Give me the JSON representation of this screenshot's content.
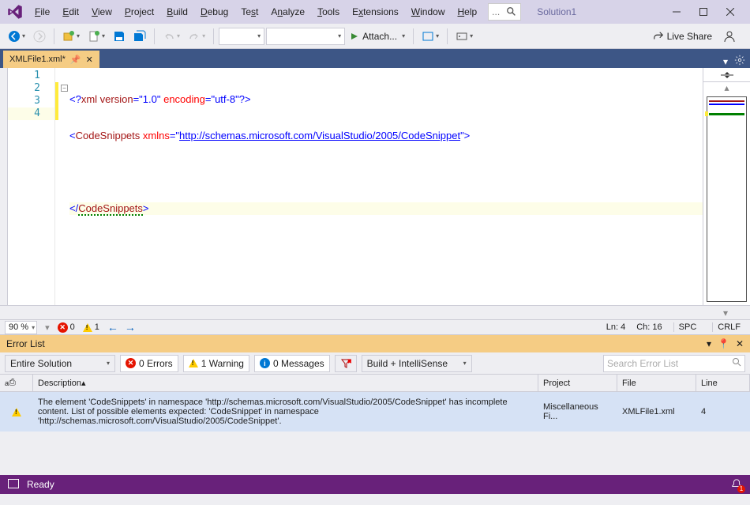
{
  "title": {
    "solution": "Solution1"
  },
  "menu": {
    "file": "File",
    "edit": "Edit",
    "view": "View",
    "project": "Project",
    "build": "Build",
    "debug": "Debug",
    "test": "Test",
    "analyze": "Analyze",
    "tools": "Tools",
    "extensions": "Extensions",
    "window": "Window",
    "help": "Help"
  },
  "search": {
    "dots": "..."
  },
  "toolbar": {
    "attach": "Attach...",
    "liveshare": "Live Share"
  },
  "tab": {
    "name": "XMLFile1.xml*"
  },
  "code": {
    "lines": [
      "1",
      "2",
      "3",
      "4"
    ],
    "l1_a": "<?",
    "l1_b": "xml version",
    "l1_c": "=\"1.0\" ",
    "l1_d": "encoding",
    "l1_e": "=\"utf-8\"",
    "l1_f": "?>",
    "l2_a": "<",
    "l2_b": "CodeSnippets ",
    "l2_c": "xmlns",
    "l2_d": "=\"",
    "l2_url": "http://schemas.microsoft.com/VisualStudio/2005/CodeSnippet",
    "l2_e": "\">",
    "l4_a": "</",
    "l4_b": "CodeSnippets",
    "l4_c": ">"
  },
  "edstatus": {
    "zoom": "90 %",
    "errors": "0",
    "warnings": "1",
    "ln": "Ln: 4",
    "ch": "Ch: 16",
    "spc": "SPC",
    "crlf": "CRLF"
  },
  "errlist": {
    "title": "Error List",
    "scope": "Entire Solution",
    "errcount": "0 Errors",
    "warncount": "1 Warning",
    "msgcount": "0 Messages",
    "build": "Build + IntelliSense",
    "search_placeholder": "Search Error List",
    "cols": {
      "desc": "Description",
      "project": "Project",
      "file": "File",
      "line": "Line"
    },
    "row": {
      "desc": "The element 'CodeSnippets' in namespace 'http://schemas.microsoft.com/VisualStudio/2005/CodeSnippet' has incomplete content. List of possible elements expected: 'CodeSnippet' in namespace 'http://schemas.microsoft.com/VisualStudio/2005/CodeSnippet'.",
      "project": "Miscellaneous Fi...",
      "file": "XMLFile1.xml",
      "line": "4"
    }
  },
  "status": {
    "ready": "Ready",
    "notifications": "1"
  }
}
